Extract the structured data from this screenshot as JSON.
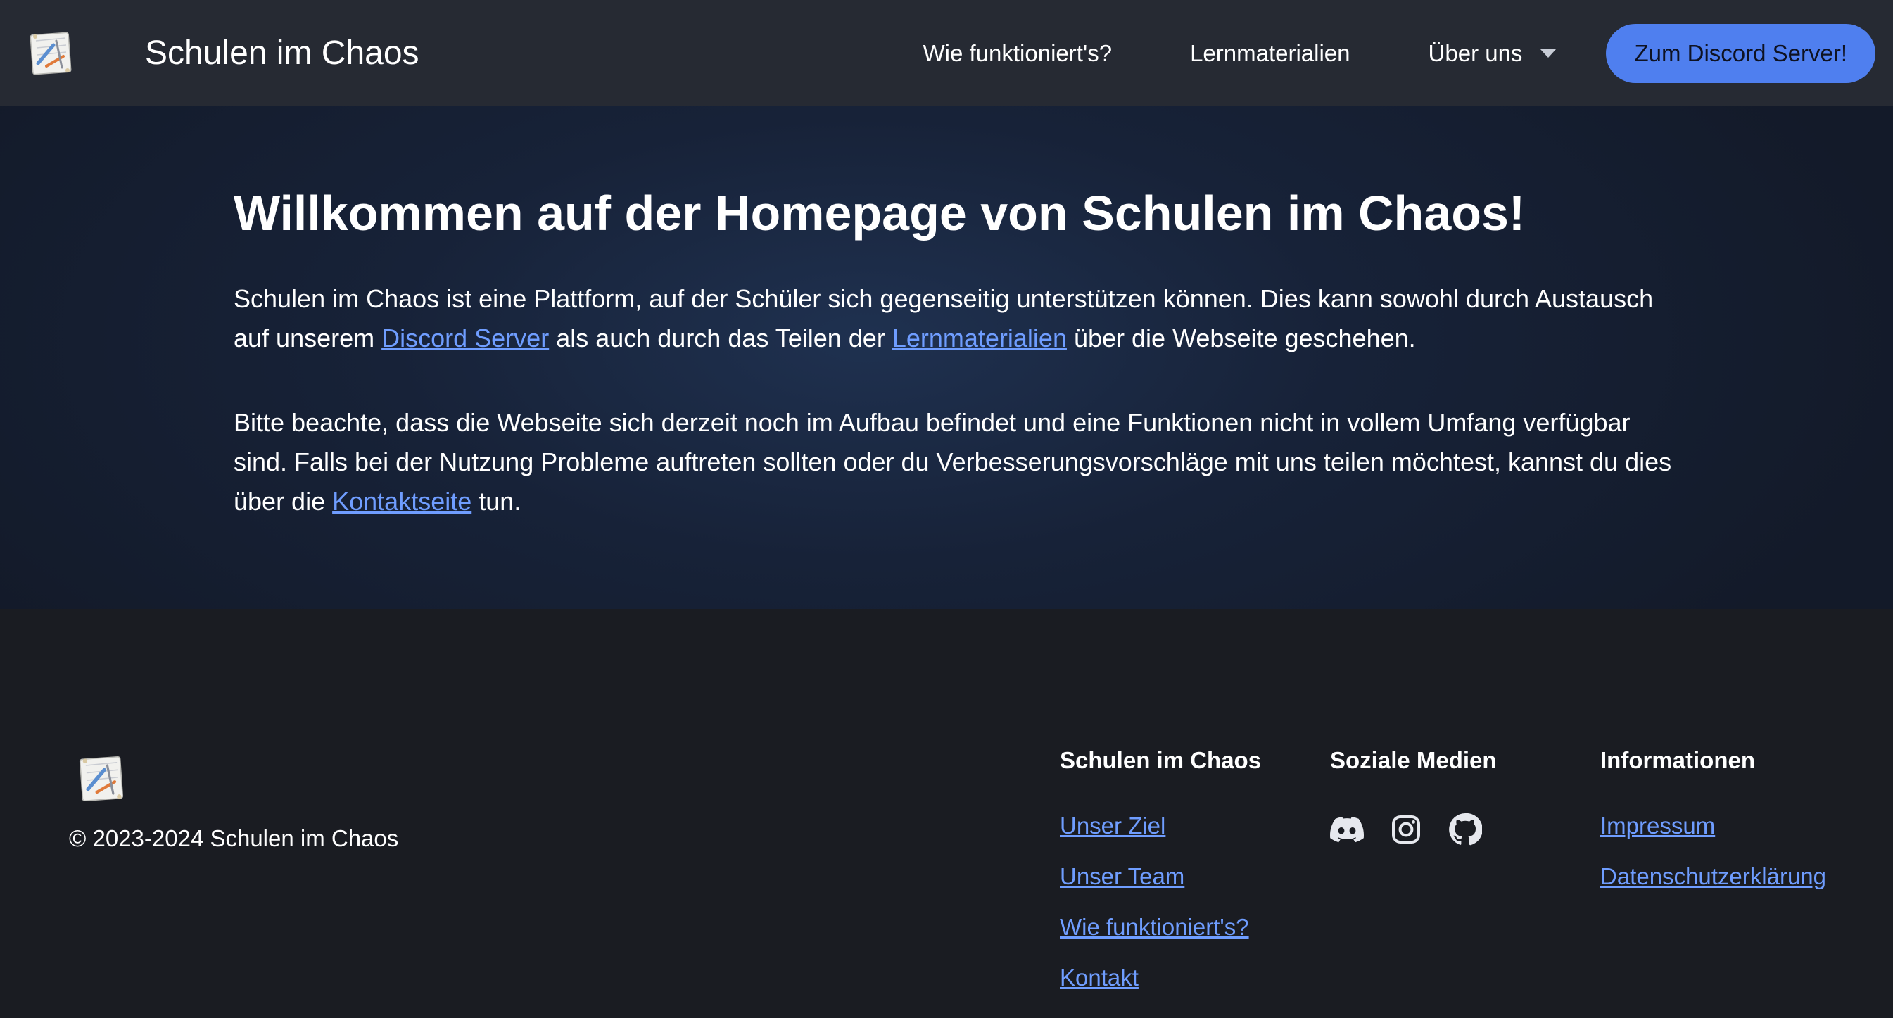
{
  "header": {
    "brand_title": "Schulen im Chaos",
    "nav": {
      "how_it_works": "Wie funktioniert's?",
      "materials": "Lernmaterialien",
      "about": "Über uns"
    },
    "discord_button": "Zum Discord Server!"
  },
  "hero": {
    "title": "Willkommen auf der Homepage von Schulen im Chaos!",
    "p1": {
      "t1": "Schulen im Chaos ist eine Plattform, auf der Schüler sich gegenseitig unterstützen können. Dies kann sowohl durch Austausch auf unserem ",
      "link1": "Discord Server",
      "t2": " als auch durch das Teilen der ",
      "link2": "Lernmaterialien",
      "t3": " über die Webseite geschehen."
    },
    "p2": {
      "t1": "Bitte beachte, dass die Webseite sich derzeit noch im Aufbau befindet und eine Funktionen nicht in vollem Umfang verfügbar sind. Falls bei der Nutzung Probleme auftreten sollten oder du Verbesserungsvorschläge mit uns teilen möchtest, kannst du dies über die ",
      "link": "Kontaktseite",
      "t2": " tun."
    }
  },
  "footer": {
    "copyright": "© 2023-2024 Schulen im Chaos",
    "col1": {
      "heading": "Schulen im Chaos",
      "links": [
        "Unser Ziel",
        "Unser Team",
        "Wie funktioniert's?",
        "Kontakt"
      ]
    },
    "col2": {
      "heading": "Soziale Medien",
      "icons": [
        "discord-icon",
        "instagram-icon",
        "github-icon"
      ]
    },
    "col3": {
      "heading": "Informationen",
      "links": [
        "Impressum",
        "Datenschutzerklärung"
      ]
    }
  },
  "colors": {
    "accent": "#4f7fef",
    "link": "#6f9dff",
    "navbar": "#262a33",
    "footer": "#1a1c22"
  }
}
